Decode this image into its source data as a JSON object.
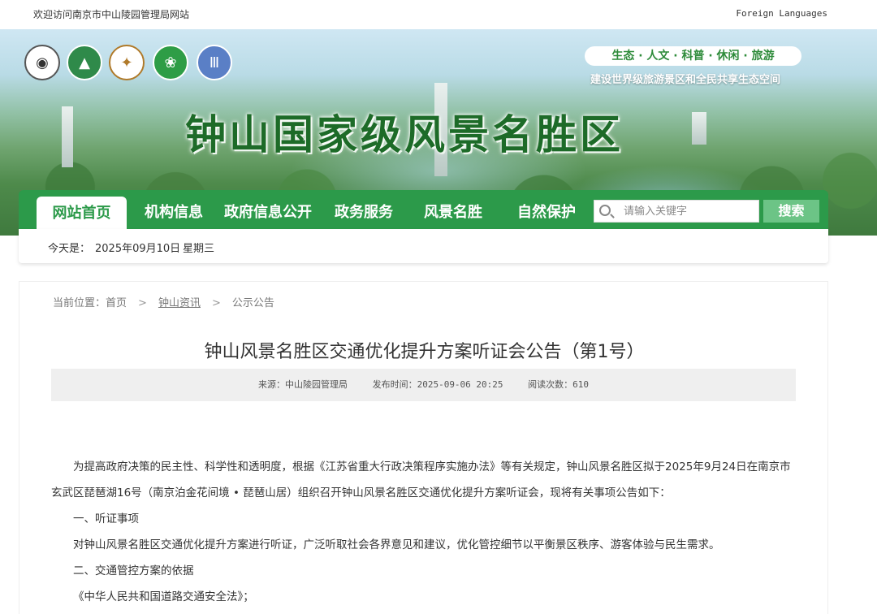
{
  "topbar": {
    "welcome": "欢迎访问南京市中山陵园管理局网站",
    "foreign": "Foreign Languages"
  },
  "banner": {
    "slogan": "生态 · 人文 · 科普 · 休闲 · 旅游",
    "subslogan": "建设世界级旅游景区和全民共享生态空间",
    "site_title": "钟山国家级风景名胜区",
    "logos": [
      "world-heritage-logo",
      "zhongshan-green-logo",
      "aaaaa-scenic-logo",
      "national-park-logo",
      "museum-logo"
    ]
  },
  "nav": {
    "items": [
      "网站首页",
      "机构信息",
      "政府信息公开",
      "政务服务",
      "风景名胜",
      "自然保护"
    ],
    "active_index": 0,
    "search_placeholder": "请输入关键字",
    "search_button": "搜索"
  },
  "datebar": {
    "label": "今天是：",
    "date": "2025年09月10日",
    "weekday": "星期三"
  },
  "breadcrumb": {
    "prefix": "当前位置：",
    "items": [
      "首页",
      "钟山资讯",
      "公示公告"
    ]
  },
  "article": {
    "title": "钟山风景名胜区交通优化提升方案听证会公告（第1号）",
    "source": "来源：中山陵园管理局",
    "published": "发布时间：2025-09-06 20:25",
    "views": "阅读次数：610",
    "paragraphs": [
      "为提高政府决策的民主性、科学性和透明度，根据《江苏省重大行政决策程序实施办法》等有关规定，钟山风景名胜区拟于2025年9月24日在南京市玄武区琵琶湖16号（南京泊金花间境 • 琵琶山居）组织召开钟山风景名胜区交通优化提升方案听证会，现将有关事项公告如下：",
      "一、听证事项",
      "对钟山风景名胜区交通优化提升方案进行听证，广泛听取社会各界意见和建议，优化管控细节以平衡景区秩序、游客体验与民生需求。",
      "二、交通管控方案的依据",
      "《中华人民共和国道路交通安全法》；"
    ]
  },
  "colors": {
    "nav_green": "#2c9a4a",
    "search_button": "#6cc486",
    "title_green": "#1d6b28",
    "meta_bg": "#efefef"
  }
}
